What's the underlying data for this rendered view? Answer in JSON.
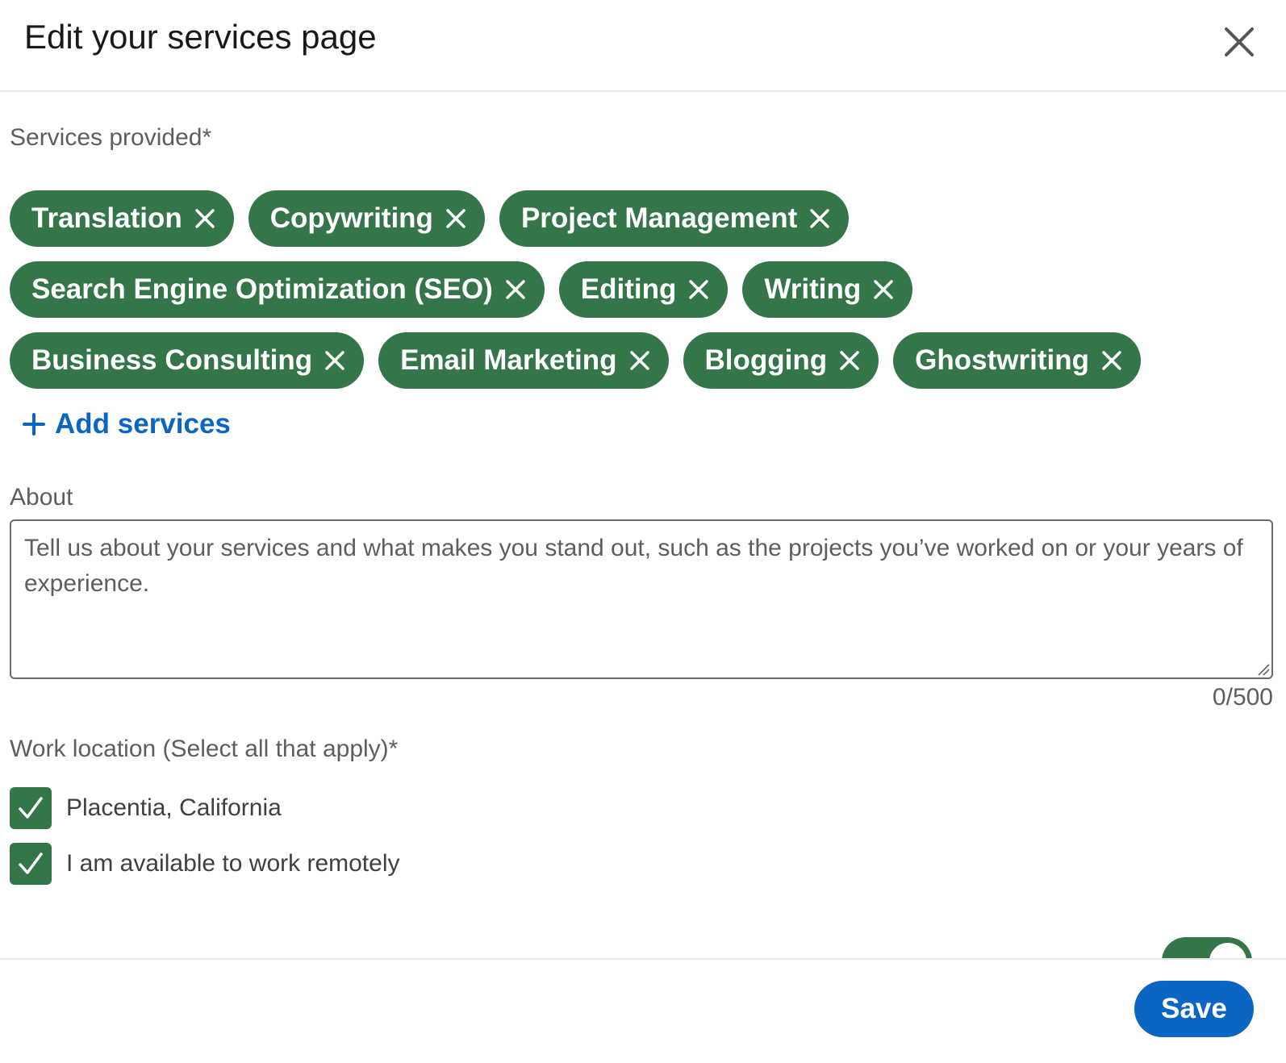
{
  "header": {
    "title": "Edit your services page",
    "close_icon": "close-icon"
  },
  "services": {
    "label": "Services provided*",
    "rows": [
      [
        "Translation",
        "Copywriting",
        "Project Management"
      ],
      [
        "Search Engine Optimization (SEO)",
        "Editing",
        "Writing"
      ],
      [
        "Business Consulting",
        "Email Marketing",
        "Blogging",
        "Ghostwriting"
      ]
    ],
    "add_label": "Add services",
    "add_icon": "plus-icon",
    "remove_icon": "close-icon"
  },
  "about": {
    "label": "About",
    "placeholder": "Tell us about your services and what makes you stand out, such as the projects you’ve worked on or your years of experience.",
    "value": "",
    "counter": "0/500"
  },
  "work_location": {
    "label": "Work location (Select all that apply)*",
    "options": [
      {
        "label": "Placentia, California",
        "checked": true
      },
      {
        "label": "I am available to work remotely",
        "checked": true
      }
    ]
  },
  "visibility_toggle": {
    "on": true
  },
  "footer": {
    "save_label": "Save"
  },
  "colors": {
    "chip_green": "#35754a",
    "link_blue": "#0a66c2",
    "text_gray": "#5e5e5e"
  }
}
